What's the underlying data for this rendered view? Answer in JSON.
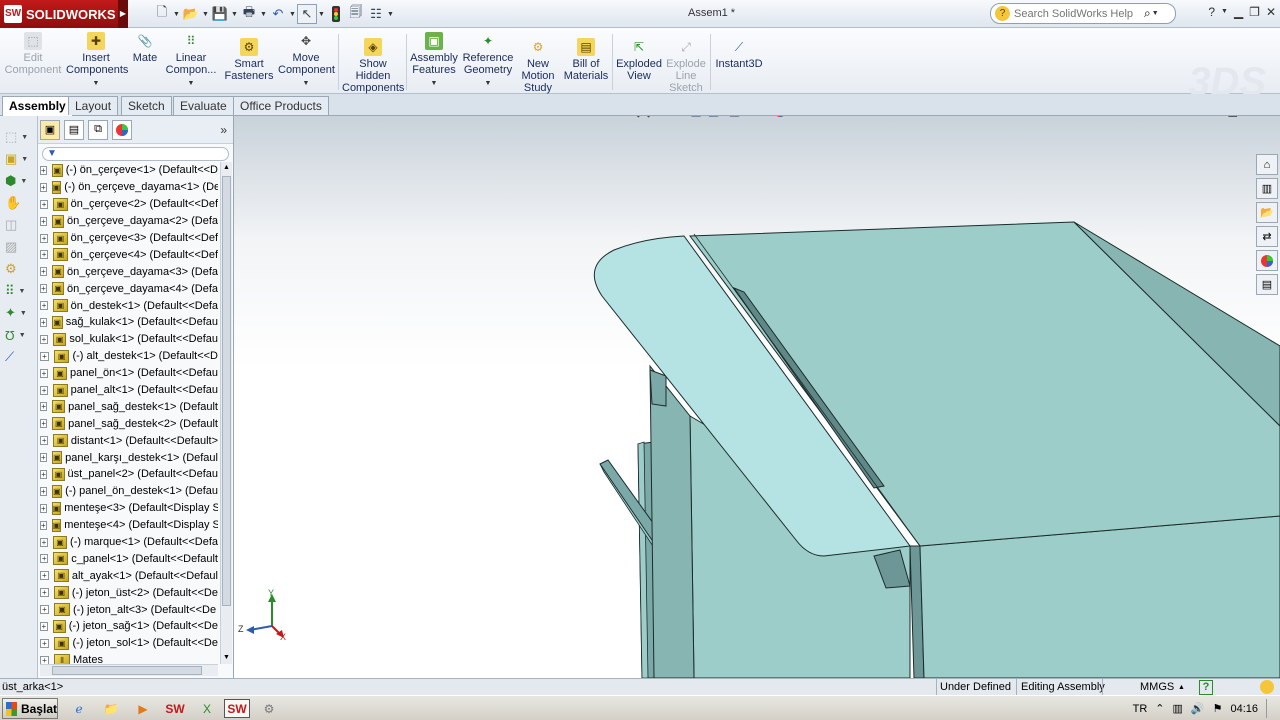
{
  "app": {
    "brand": "SOLIDWORKS",
    "document_title": "Assem1 *",
    "search_placeholder": "Search SolidWorks Help"
  },
  "quick_access": [
    {
      "icon": "new-document-icon"
    },
    {
      "icon": "open-folder-icon"
    },
    {
      "icon": "save-icon"
    },
    {
      "icon": "print-icon"
    },
    {
      "icon": "undo-icon"
    },
    {
      "icon": "select-arrow-icon"
    },
    {
      "icon": "rebuild-traffic-light-icon"
    },
    {
      "icon": "file-properties-icon"
    },
    {
      "icon": "options-icon"
    }
  ],
  "ribbon": {
    "edit_component": {
      "line1": "Edit",
      "line2": "Component"
    },
    "insert_components": {
      "line1": "Insert",
      "line2": "Components"
    },
    "mate": {
      "line1": "Mate"
    },
    "linear_component": {
      "line1": "Linear",
      "line2": "Compon..."
    },
    "smart_fasteners": {
      "line1": "Smart",
      "line2": "Fasteners"
    },
    "move_component": {
      "line1": "Move",
      "line2": "Component"
    },
    "show_hidden": {
      "line1": "Show",
      "line2": "Hidden",
      "line3": "Components"
    },
    "assembly_features": {
      "line1": "Assembly",
      "line2": "Features"
    },
    "reference_geometry": {
      "line1": "Reference",
      "line2": "Geometry"
    },
    "new_motion_study": {
      "line1": "New",
      "line2": "Motion",
      "line3": "Study"
    },
    "bill_of_materials": {
      "line1": "Bill of",
      "line2": "Materials"
    },
    "exploded_view": {
      "line1": "Exploded",
      "line2": "View"
    },
    "explode_line_sketch": {
      "line1": "Explode",
      "line2": "Line",
      "line3": "Sketch"
    },
    "instant3d": {
      "line1": "Instant3D"
    }
  },
  "tabs": [
    "Assembly",
    "Layout",
    "Sketch",
    "Evaluate",
    "Office Products"
  ],
  "feature_tree": {
    "items": [
      "(-) ön_çerçeve<1> (Default<<D",
      "(-) ön_çerçeve_dayama<1> (De",
      "ön_çerçeve<2> (Default<<Def",
      "ön_çerçeve_dayama<2> (Defa",
      "ön_çerçeve<3> (Default<<Def",
      "ön_çerçeve<4> (Default<<Def",
      "ön_çerçeve_dayama<3> (Defa",
      "ön_çerçeve_dayama<4> (Defa",
      "ön_destek<1> (Default<<Defa",
      "sağ_kulak<1> (Default<<Defau",
      "sol_kulak<1> (Default<<Defau",
      "(-) alt_destek<1> (Default<<D",
      "panel_ön<1> (Default<<Defau",
      "panel_alt<1> (Default<<Defau",
      "panel_sağ_destek<1> (Default",
      "panel_sağ_destek<2> (Default",
      "distant<1> (Default<<Default>",
      "panel_karşı_destek<1> (Defaul",
      "üst_panel<2> (Default<<Defau",
      "(-) panel_ön_destek<1> (Defau",
      "menteşe<3> (Default<Display S",
      "menteşe<4> (Default<Display S",
      "(-) marque<1> (Default<<Defa",
      "c_panel<1> (Default<<Default",
      "alt_ayak<1> (Default<<Defaul",
      "(-) jeton_üst<2> (Default<<De",
      "(-) jeton_alt<3> (Default<<De",
      "(-) jeton_sağ<1> (Default<<De",
      "(-) jeton_sol<1> (Default<<De",
      "Mates"
    ]
  },
  "triad": {
    "y": "Y",
    "z": "Z",
    "x": "X"
  },
  "status": {
    "selection": "üst_arka<1>",
    "definition": "Under Defined",
    "mode": "Editing Assembly",
    "units": "MMGS",
    "help": "?"
  },
  "taskbar": {
    "start_label": "Başlat",
    "language": "TR",
    "clock": "04:16"
  },
  "colors": {
    "panel_top": "#b5e3e3",
    "panel_main": "#9ccdc9",
    "panel_side": "#7aa9a7",
    "frame_dark": "#6c9796",
    "brand_red": "#b31515"
  }
}
